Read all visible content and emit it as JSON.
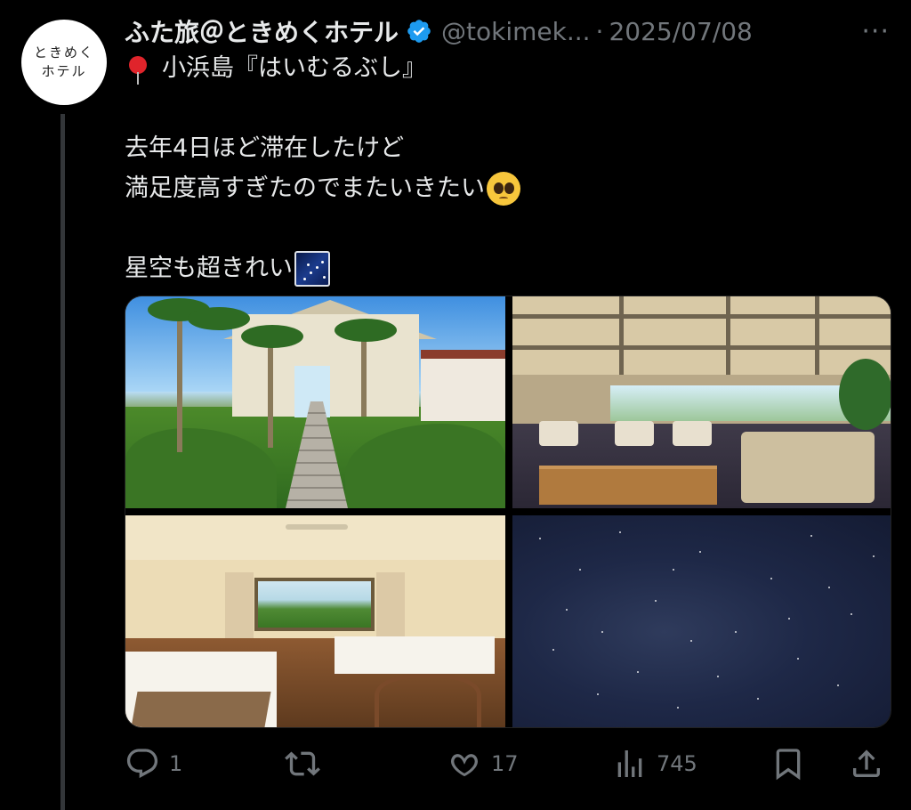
{
  "tweet": {
    "avatar": {
      "line1": "ときめく",
      "line2": "ホテル"
    },
    "display_name": "ふた旅＠ときめくホテル",
    "handle": "@tokimek...",
    "separator": "·",
    "date": "2025/07/08",
    "more": "···",
    "verified": true,
    "text": {
      "line1": "小浜島『はいむるぶし』",
      "line2": "去年4日ほど滞在したけど",
      "line3": "満足度高すぎたのでまたいきたい",
      "line4": "星空も超きれい"
    },
    "emojis": {
      "line1": "round-pushpin",
      "line3": "pleading-face",
      "line4": "milky-way"
    },
    "media": [
      {
        "name": "garden-path-photo"
      },
      {
        "name": "hotel-lobby-photo"
      },
      {
        "name": "hotel-bedroom-photo"
      },
      {
        "name": "starry-sky-photo"
      }
    ],
    "actions": {
      "reply_count": "1",
      "retweet_count": "",
      "like_count": "17",
      "views_count": "745"
    }
  },
  "colors": {
    "background": "#000000",
    "text": "#e7e9ea",
    "muted": "#71767b",
    "verified": "#1d9bf0",
    "thread_line": "#333639"
  }
}
